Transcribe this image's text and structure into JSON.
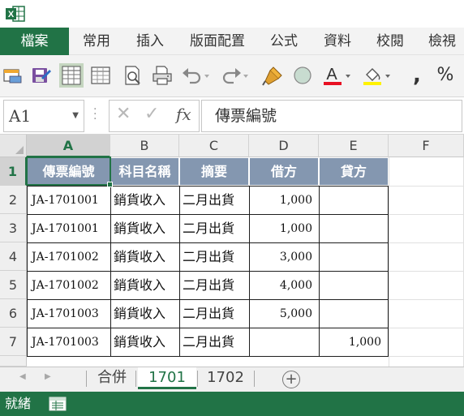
{
  "app": {
    "icon": "excel-icon",
    "accent_color": "#217346",
    "header_fill_color": "#8497b0"
  },
  "ribbon": {
    "tabs": [
      {
        "label": "檔案",
        "active": true
      },
      {
        "label": "常用"
      },
      {
        "label": "插入"
      },
      {
        "label": "版面配置"
      },
      {
        "label": "公式"
      },
      {
        "label": "資料"
      },
      {
        "label": "校閱"
      },
      {
        "label": "檢視"
      }
    ]
  },
  "toolbar": {
    "icons": [
      "new-document-icon",
      "save-icon",
      "table-format-icon",
      "borders-icon",
      "print-preview-icon",
      "print-icon",
      "undo-icon",
      "redo-icon",
      "format-painter-icon",
      "circle-shape-icon",
      "font-color-icon",
      "fill-color-icon",
      "comma-style-icon",
      "percent-style-icon"
    ],
    "comma_symbol": ",",
    "percent_symbol": "%",
    "font_color": "#e81123",
    "fill_color": "#fff200"
  },
  "formula_bar": {
    "name_box": "A1",
    "fx_label": "fx",
    "formula": "傳票編號"
  },
  "grid": {
    "columns": [
      "A",
      "B",
      "C",
      "D",
      "E",
      "F"
    ],
    "rows": [
      "1",
      "2",
      "3",
      "4",
      "5",
      "6",
      "7"
    ],
    "selected_cell": "A1",
    "header_row": [
      "傳票編號",
      "科目名稱",
      "摘要",
      "借方",
      "貸方"
    ],
    "data_rows": [
      [
        "JA-1701001",
        "銷貨收入",
        "二月出貨",
        "1,000",
        ""
      ],
      [
        "JA-1701001",
        "銷貨收入",
        "二月出貨",
        "1,000",
        ""
      ],
      [
        "JA-1701002",
        "銷貨收入",
        "二月出貨",
        "3,000",
        ""
      ],
      [
        "JA-1701002",
        "銷貨收入",
        "二月出貨",
        "4,000",
        ""
      ],
      [
        "JA-1701003",
        "銷貨收入",
        "二月出貨",
        "5,000",
        ""
      ],
      [
        "JA-1701003",
        "銷貨收入",
        "二月出貨",
        "",
        "1,000"
      ]
    ]
  },
  "sheets": {
    "tabs": [
      "合併",
      "1701",
      "1702"
    ],
    "active": "1701"
  },
  "status": {
    "text": "就緒"
  }
}
